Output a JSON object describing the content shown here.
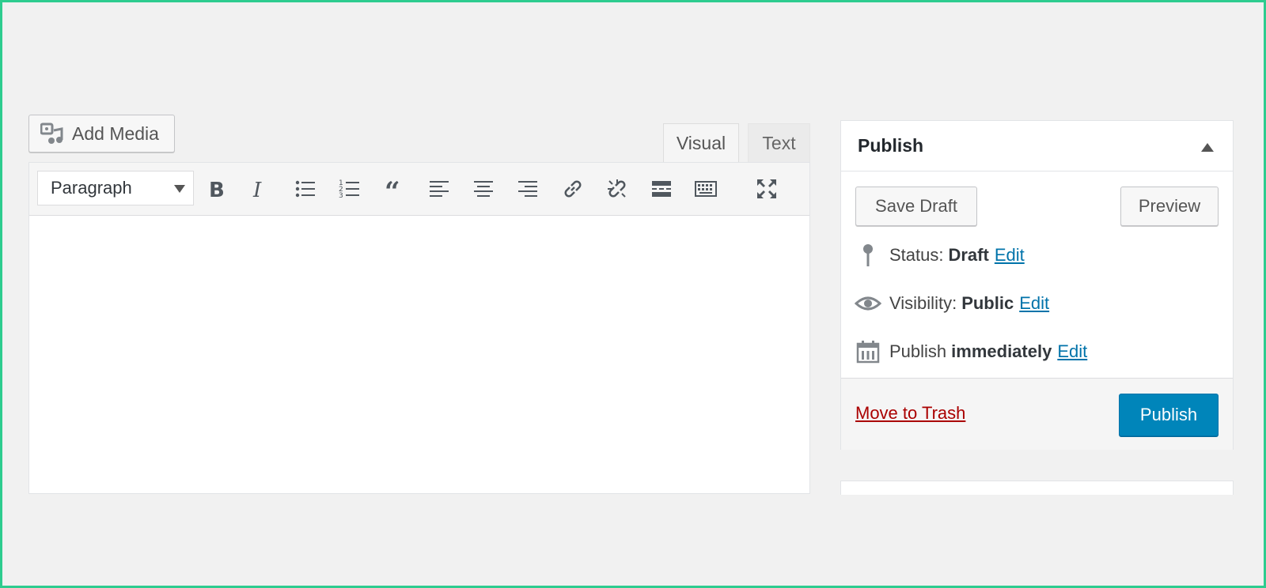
{
  "editor": {
    "add_media_label": "Add Media",
    "tabs": [
      {
        "label": "Visual",
        "active": true
      },
      {
        "label": "Text",
        "active": false
      }
    ],
    "format_select": {
      "value": "Paragraph"
    },
    "toolbar_icons": [
      "bold-icon",
      "italic-icon",
      "bulleted-list-icon",
      "numbered-list-icon",
      "blockquote-icon",
      "align-left-icon",
      "align-center-icon",
      "align-right-icon",
      "link-icon",
      "unlink-icon",
      "read-more-icon",
      "toolbar-toggle-icon",
      "fullscreen-icon"
    ]
  },
  "publish": {
    "title": "Publish",
    "save_draft_label": "Save Draft",
    "preview_label": "Preview",
    "status": {
      "label": "Status:",
      "value": "Draft",
      "edit": "Edit"
    },
    "visibility": {
      "label": "Visibility:",
      "value": "Public",
      "edit": "Edit"
    },
    "schedule": {
      "label": "Publish",
      "value": "immediately",
      "edit": "Edit"
    },
    "trash_label": "Move to Trash",
    "publish_label": "Publish"
  },
  "colors": {
    "accent": "#0085ba",
    "link": "#0073aa",
    "danger": "#a00000",
    "frame": "#2ecc8f"
  }
}
